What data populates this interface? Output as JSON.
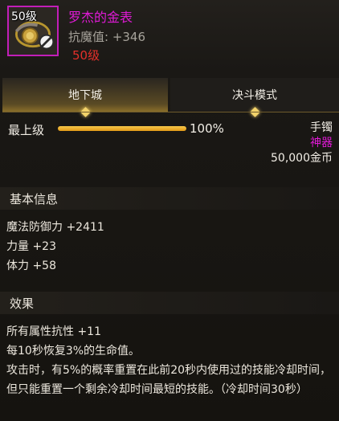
{
  "item": {
    "name": "罗杰的金表",
    "level_tag": "50级",
    "stat_line": "抗魔值: +346",
    "level_requirement": "50级",
    "frame_color": "#c21eb8"
  },
  "tabs": [
    {
      "label": "地下城",
      "active": true
    },
    {
      "label": "决斗模式",
      "active": false
    }
  ],
  "level": {
    "label": "最上级",
    "progress_percent": 100,
    "percent_text": "100%"
  },
  "info": {
    "type": "手镯",
    "rarity": "神器",
    "price": "50,000金币"
  },
  "basic": {
    "title": "基本信息",
    "lines": [
      "魔法防御力 +2411",
      "力量 +23",
      "体力 +58"
    ]
  },
  "effect": {
    "title": "效果",
    "lines": [
      "所有属性抗性 +11",
      "每10秒恢复3%的生命值。"
    ],
    "paragraph": "攻击时，有5%的概率重置在此前20秒内使用过的技能冷却时间，但只能重置一个剩余冷却时间最短的技能。（冷却时间30秒）"
  },
  "icons": {
    "item": "gold-watch-bracelet-icon",
    "lock": "no-entry-icon",
    "tab_marker": "diamond-icon"
  },
  "colors": {
    "epic": "#e01ad6",
    "requirement": "#e3302a",
    "bar": "#f0b030"
  }
}
